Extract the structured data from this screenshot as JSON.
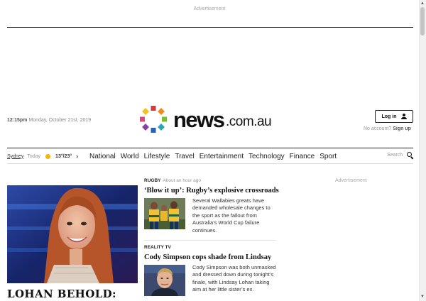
{
  "top_ad": {
    "label": "Advertisement"
  },
  "masthead": {
    "time": "12:15pm",
    "date": "Monday, October 21st, 2019",
    "logo": {
      "brand": "news",
      "domain": ".com.au"
    },
    "login_label": "Log in",
    "no_account_text": "No account?",
    "signup_label": "Sign up"
  },
  "weather": {
    "city": "Sydney",
    "day": "Today",
    "temps": "13°/23°"
  },
  "nav": {
    "items": [
      "National",
      "World",
      "Lifestyle",
      "Travel",
      "Entertainment",
      "Technology",
      "Finance",
      "Sport"
    ],
    "search_label": "Search"
  },
  "hero": {
    "title": "LOHAN BEHOLD:"
  },
  "articles": [
    {
      "kicker": "Rugby",
      "ago": "About an hour ago",
      "headline": "‘Blow it up’: Rugby’s explosive crossroads",
      "summary": "Several Wallabies greats have demanded wholesale changes to the sport as the fallout from Australia’s World Cup failure continues."
    },
    {
      "kicker": "Reality TV",
      "ago": "",
      "headline": "Cody Simpson cops shade from Lindsay",
      "summary": "Cody Simpson was both unmasked and dressed down during tonight’s finale, with Lindsay Lohan taking aim at her little sister’s ex."
    }
  ],
  "right_ad": {
    "label": "Advertisement"
  },
  "colors": {
    "dots": [
      "#d63b3b",
      "#f08a1c",
      "#7dbb36",
      "#2aa4b8",
      "#2e5fb5",
      "#8c3fa8",
      "#e0457b",
      "#f2c21a"
    ]
  }
}
